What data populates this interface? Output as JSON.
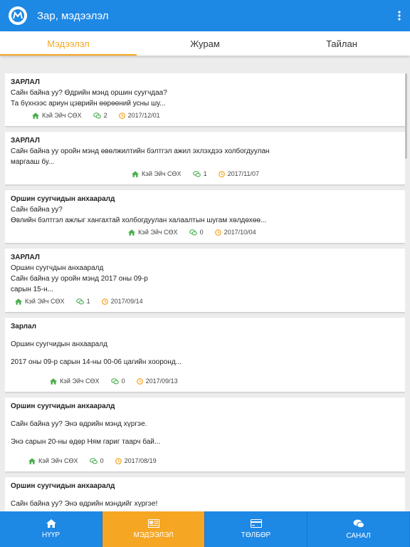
{
  "appbar": {
    "title": "Зар, мэдээлэл"
  },
  "tabs": [
    {
      "label": "Мэдээлэл",
      "active": true
    },
    {
      "label": "Журам",
      "active": false
    },
    {
      "label": "Тайлан",
      "active": false
    }
  ],
  "cards": [
    {
      "title": "ЗАРЛАЛ",
      "lines": [
        "Сайн байна уу? Өдрийн мэнд оршин суугчдаа?",
        "Та бүхнээс ариун цэврийн өөрөөний усны шу..."
      ],
      "author": "Кэй Эйч СӨХ",
      "comments": "2",
      "date": "2017/12/01"
    },
    {
      "title": "ЗАРЛАЛ",
      "lines": [
        "Сайн байна уу оройн мэнд өвөлжилтийн бэлтгэл ажил эхлэхдээ холбогдуулан",
        "маргааш бу..."
      ],
      "author": "Кэй Эйч СӨХ",
      "comments": "1",
      "date": "2017/11/07"
    },
    {
      "title": "Оршин суугчидын анхааралд",
      "lines": [
        "Сайн байна уу?",
        "Өвлийн бэлтгэл ажлыг хангахтай холбогдуулан халаалтын шугам хөлдөхөө..."
      ],
      "author": "Кэй Эйч СӨХ",
      "comments": "0",
      "date": "2017/10/04"
    },
    {
      "title": "ЗАРЛАЛ",
      "lines": [
        "Оршин суугчдын анхааралд",
        "Сайн байна уу оройн мэнд 2017 оны 09-р",
        "сарын 15-н..."
      ],
      "author": "Кэй Эйч СӨХ",
      "comments": "1",
      "date": "2017/09/14"
    },
    {
      "title": "Зарлал",
      "lines": [
        "Оршин суугчидын анхааралд",
        "2017 оны 09-р сарын 14-ны  00-06 цагийн хооронд..."
      ],
      "author": "Кэй Эйч СӨХ",
      "comments": "0",
      "date": "2017/09/13"
    },
    {
      "title": "Оршин суугчидын анхааралд",
      "lines": [
        "Сайн байна уу? Энэ өдрийн мэнд хүргэе.",
        "Энэ сарын 20-ны өдөр Ням гариг таарч бай..."
      ],
      "author": "Кэй Эйч СӨХ",
      "comments": "0",
      "date": "2017/08/19"
    },
    {
      "title": "Оршин суугчидын анхааралд",
      "lines": [
        "Сайн байна уу? Энэ өдрийн мэндийг хүргэе!"
      ],
      "author": "",
      "comments": "",
      "date": ""
    }
  ],
  "bottom_nav": [
    {
      "label": "НҮҮР",
      "icon": "home-icon",
      "active": false
    },
    {
      "label": "МЭДЭЭЛЭЛ",
      "icon": "news-icon",
      "active": true
    },
    {
      "label": "ТӨЛБӨР",
      "icon": "card-icon",
      "active": false
    },
    {
      "label": "САНАЛ",
      "icon": "chat-icon",
      "active": false
    }
  ],
  "colors": {
    "primary": "#1e88e5",
    "accent": "#f5a623",
    "home_icon": "#4caf50",
    "comment_icon": "#4caf50",
    "clock_icon": "#f5a623"
  }
}
